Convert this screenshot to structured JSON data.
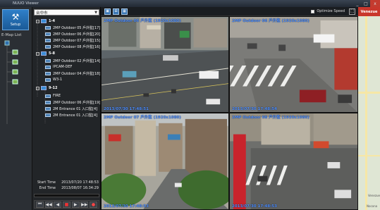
{
  "window": {
    "title": "NUUO Viewer",
    "controls": [
      "_",
      "□",
      "x"
    ]
  },
  "left_rail": {
    "setup_label": "Setup",
    "emap_label": "E-Map List"
  },
  "device_panel": {
    "location_select": "台中市",
    "groups": [
      {
        "label": "1-4",
        "cameras": [
          "2MP Outdoor 05 戶外監[17]",
          "2MP Outdoor 06 戶外監[20]",
          "2MP Outdoor 07 戶外監[15]",
          "2MP Outdoor 08 戶外監[16]"
        ]
      },
      {
        "label": "5-8",
        "cameras": [
          "2MP Outdoor 02 戶外監[14]",
          "IPCAM-DEF",
          "2MP Outdoor 04 戶外監[18]",
          "W3-1"
        ]
      },
      {
        "label": "9-12",
        "cameras": [
          "FIRE",
          "2MP Outdoor 06 戶外監[19]",
          "2M Entrance 01 入口監[4]",
          "2M Entrance 01 入口監[4]"
        ]
      }
    ],
    "start_time_label": "Start Time",
    "start_time_value": "2013/07/20 17:48:53",
    "end_time_label": "End Time",
    "end_time_value": "2013/08/07 16:34:29",
    "playback_progress": 0.0
  },
  "toolbar": {
    "optimize_speed_label": "Optimize Speed",
    "optimize_speed_checked": false
  },
  "views": [
    {
      "title": "2MP Outdoor 06 戶外監 (1920x1080)",
      "timestamp": "2013/07/30 17:48:51"
    },
    {
      "title": "2MP Outdoor 06 戶外監 (1920x1080)",
      "timestamp": "2013/07/30 17:48:54"
    },
    {
      "title": "2MP Outdoor 07 戶外監 (1920x1080)",
      "timestamp": "2013/07/30 17:48:53"
    },
    {
      "title": "2MP Outdoor 08 戶外監 (1920x1080)",
      "timestamp": "2013/07/30 17:48:53"
    }
  ],
  "right_strip": {
    "header": "Venezue",
    "labels": [
      "Venezue",
      "Nocona"
    ]
  },
  "colors": {
    "overlay_text": "#4f8fff",
    "setup_button": "#2a74bd",
    "close_button": "#c43b2f"
  }
}
